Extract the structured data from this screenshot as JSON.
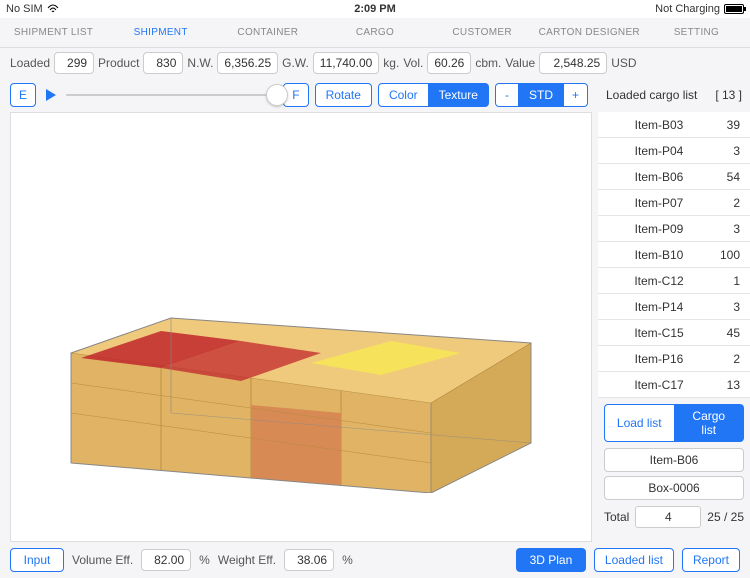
{
  "status": {
    "left": "No SIM",
    "time": "2:09 PM",
    "right": "Not Charging"
  },
  "tabs": [
    "SHIPMENT LIST",
    "SHIPMENT",
    "CONTAINER",
    "CARGO",
    "CUSTOMER",
    "CARTON DESIGNER",
    "SETTING"
  ],
  "active_tab": 1,
  "summary": {
    "loaded_label": "Loaded",
    "loaded": "299",
    "product_label": "Product",
    "product": "830",
    "nw_label": "N.W.",
    "nw": "6,356.25",
    "gw_label": "G.W.",
    "gw": "11,740.00",
    "gw_unit": "kg.",
    "vol_label": "Vol.",
    "vol": "60.26",
    "vol_unit": "cbm.",
    "value_label": "Value",
    "value": "2,548.25",
    "value_unit": "USD"
  },
  "toolbar": {
    "e": "E",
    "f": "F",
    "rotate": "Rotate",
    "color": "Color",
    "texture": "Texture",
    "minus": "-",
    "std": "STD",
    "plus": "+"
  },
  "cargo_header": {
    "title": "Loaded cargo list",
    "count": "[ 13 ]"
  },
  "cargo": [
    {
      "name": "Item-B03",
      "qty": "39"
    },
    {
      "name": "Item-P04",
      "qty": "3"
    },
    {
      "name": "Item-B06",
      "qty": "54"
    },
    {
      "name": "Item-P07",
      "qty": "2"
    },
    {
      "name": "Item-P09",
      "qty": "3"
    },
    {
      "name": "Item-B10",
      "qty": "100"
    },
    {
      "name": "Item-C12",
      "qty": "1"
    },
    {
      "name": "Item-P14",
      "qty": "3"
    },
    {
      "name": "Item-C15",
      "qty": "45"
    },
    {
      "name": "Item-P16",
      "qty": "2"
    },
    {
      "name": "Item-C17",
      "qty": "13"
    }
  ],
  "seg": {
    "load_list": "Load list",
    "cargo_list": "Cargo list"
  },
  "selected_item": "Item-B06",
  "selected_box": "Box-0006",
  "totals": {
    "label": "Total",
    "count": "4",
    "ratio": "25 / 25"
  },
  "bottom": {
    "input": "Input",
    "vol_eff_label": "Volume Eff.",
    "vol_eff": "82.00",
    "pct1": "%",
    "wt_eff_label": "Weight Eff.",
    "wt_eff": "38.06",
    "pct2": "%",
    "plan3d": "3D Plan",
    "loaded_list": "Loaded list",
    "report": "Report"
  }
}
